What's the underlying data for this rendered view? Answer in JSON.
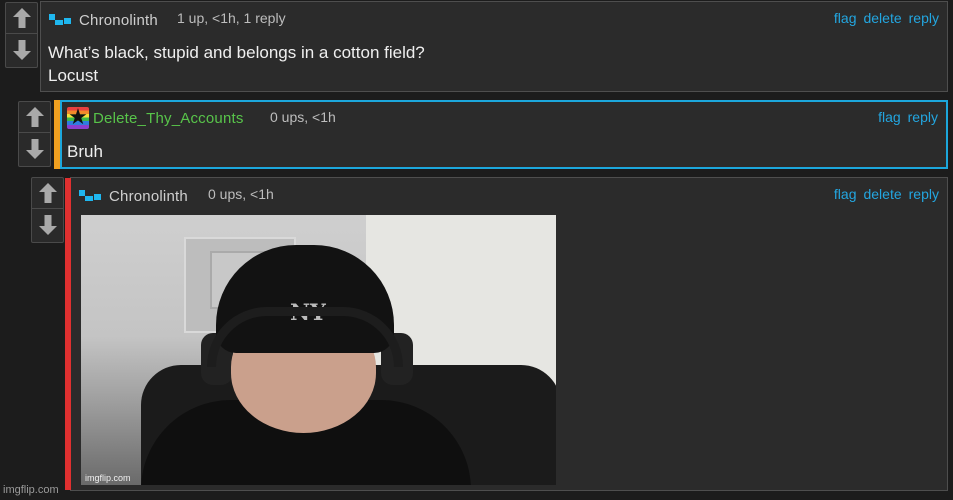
{
  "comments": [
    {
      "user": "Chronolinth",
      "meta": "1 up, <1h, 1 reply",
      "actions": [
        "flag",
        "delete",
        "reply"
      ],
      "body_lines": [
        "What’s black, stupid and belongs in a cotton field?",
        "Locust"
      ],
      "accent_color": ""
    },
    {
      "user": "Delete_Thy_Accounts",
      "meta": "0 ups, <1h",
      "actions": [
        "flag",
        "reply"
      ],
      "body_lines": [
        "Bruh"
      ],
      "accent_color": "#f0a020",
      "user_color": "#58c44a",
      "highlight_border": "#1ca7dc"
    },
    {
      "user": "Chronolinth",
      "meta": "0 ups, <1h",
      "actions": [
        "flag",
        "delete",
        "reply"
      ],
      "image": {
        "description_icon": "meme-image",
        "watermark": "imgflip.com"
      },
      "accent_color": "#e03030"
    }
  ],
  "vote_icons": [
    "upvote-arrow-icon",
    "downvote-arrow-icon"
  ],
  "footer_watermark": "imgflip.com",
  "colors": {
    "link": "#23a6e0",
    "background": "#1c1c1c",
    "panel": "#2b2b2b"
  }
}
